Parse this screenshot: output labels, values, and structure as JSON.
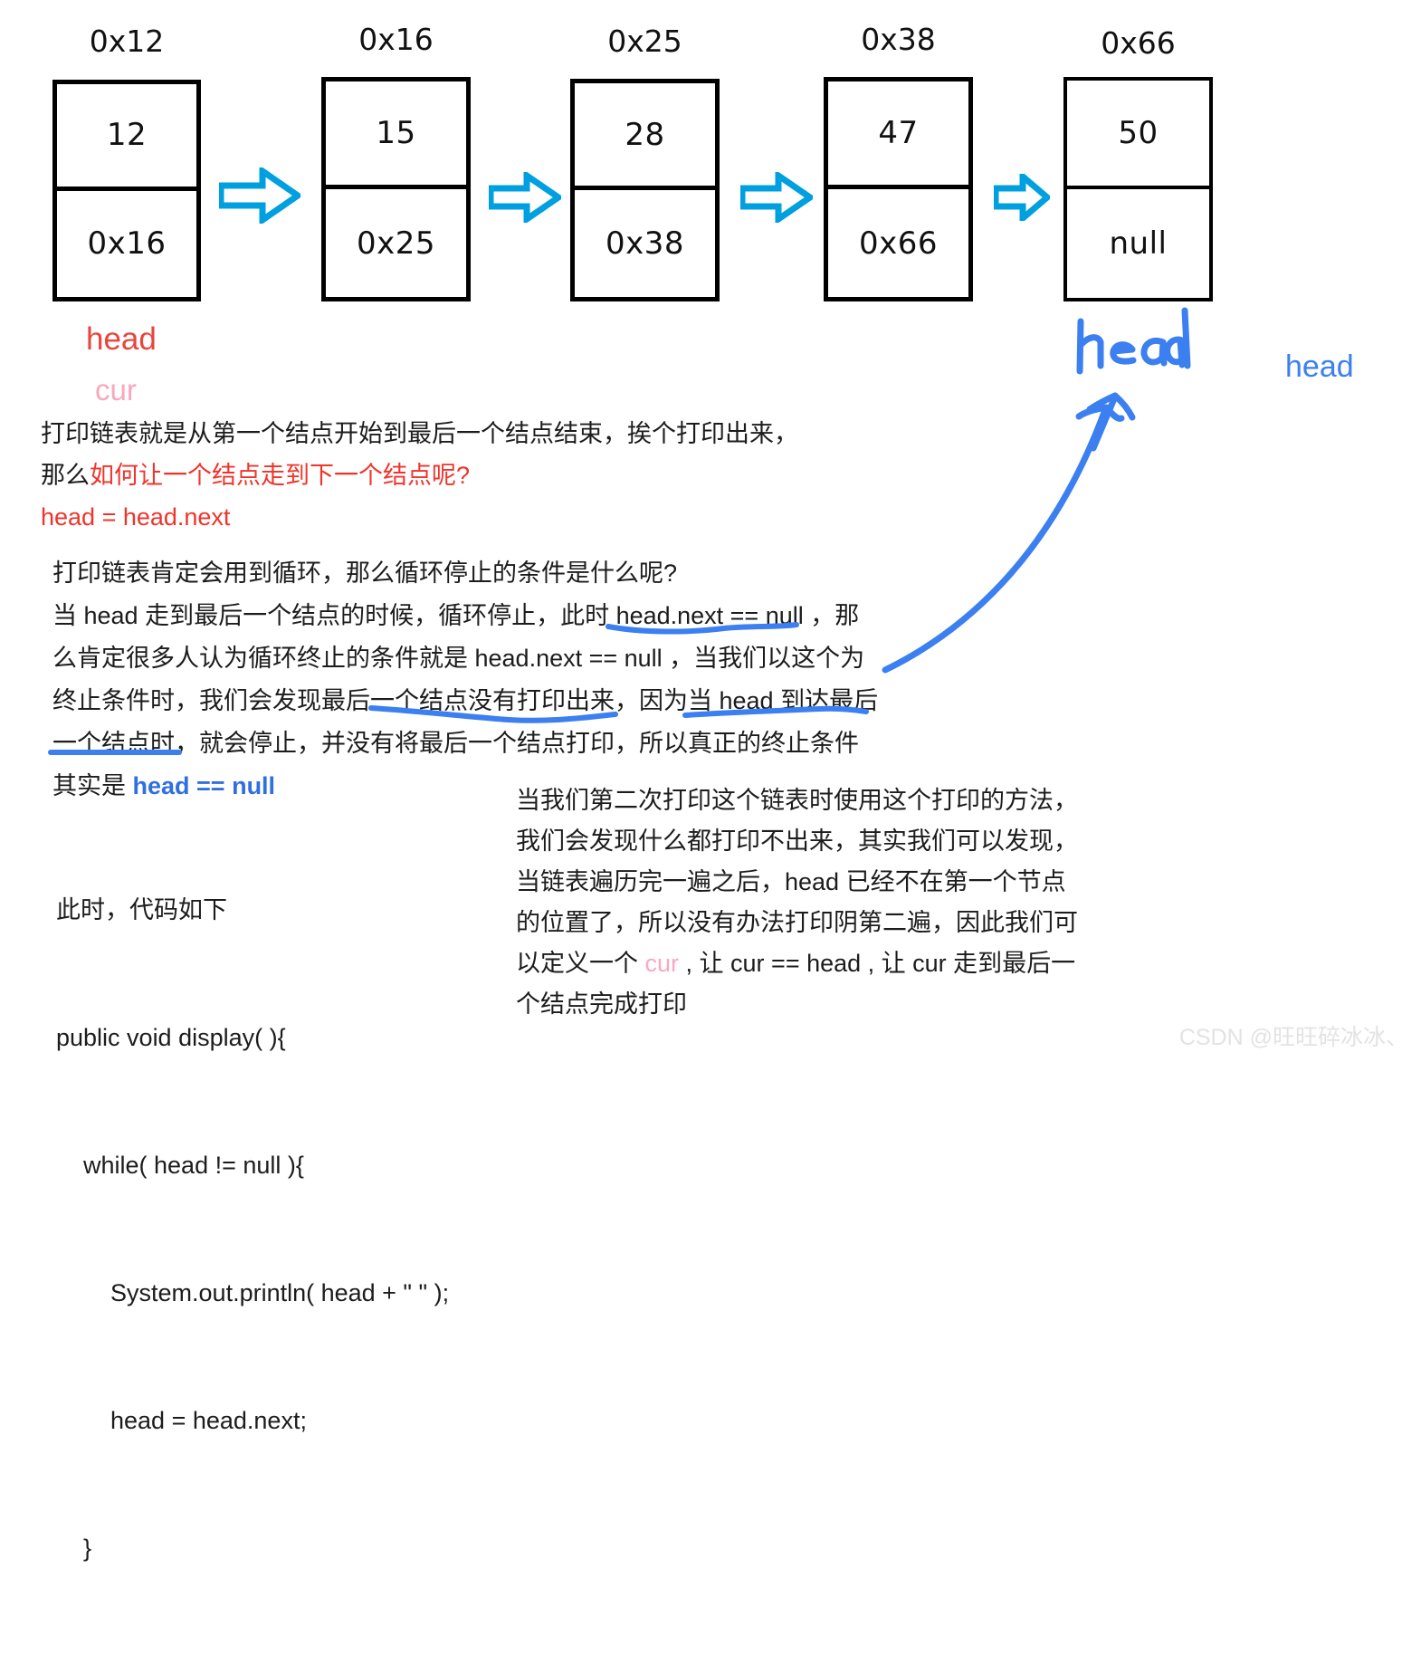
{
  "diagram": {
    "nodes": [
      {
        "address": "0x12",
        "value": "12",
        "next": "0x16"
      },
      {
        "address": "0x16",
        "value": "15",
        "next": "0x25"
      },
      {
        "address": "0x25",
        "value": "28",
        "next": "0x38"
      },
      {
        "address": "0x38",
        "value": "47",
        "next": "0x66"
      },
      {
        "address": "0x66",
        "value": "50",
        "next": "null"
      }
    ],
    "arrow_icon": "right-arrow-icon",
    "pointer_labels": {
      "head_red": "head",
      "cur_pink": "cur",
      "head_handwritten": "head",
      "head_blue": "head"
    }
  },
  "notes": {
    "intro": {
      "line1": "打印链表就是从第一个结点开始到最后一个结点结束，挨个打印出来，",
      "line2_prefix": "那么",
      "line2_red": "如何让一个结点走到下一个结点呢?",
      "line3_red": "head = head.next"
    },
    "body": {
      "line1": "打印链表肯定会用到循环，那么循环停止的条件是什么呢?",
      "line2": "当 head 走到最后一个结点的时候，循环停止，此时 head.next == null ，那",
      "line3": "么肯定很多人认为循环终止的条件就是 head.next == null ，当我们以这个为",
      "line4": "终止条件时，我们会发现最后一个结点没有打印出来，因为当 head 到达最后",
      "line5": "一个结点时，就会停止，并没有将最后一个结点打印，所以真正的终止条件",
      "line6_prefix": "其实是 ",
      "line6_blue": "head  == null"
    },
    "code": {
      "caption": "此时，代码如下",
      "lines": [
        "public void display( ){",
        "    while( head != null ){",
        "        System.out.println( head + \" \" );",
        "        head = head.next;",
        "    }"
      ]
    },
    "right_paragraph": {
      "line1": "当我们第二次打印这个链表时使用这个打印的方法，",
      "line2": "我们会发现什么都打印不出来，其实我们可以发现，",
      "line3": "当链表遍历完一遍之后，head 已经不在第一个节点",
      "line4": "的位置了，所以没有办法打印阴第二遍，因此我们可",
      "line5_a": "以定义一个 ",
      "line5_cur": "cur",
      "line5_b": " , 让 cur == head , 让 cur 走到最后一",
      "line6": "个结点完成打印"
    }
  },
  "watermark": "CSDN @旺旺碎冰冰、",
  "colors": {
    "node_border": "#000000",
    "arrow_blue": "#00a0e0",
    "red_text": "#f0342b",
    "pink_text": "#f8a9c0",
    "blue_text": "#2f6fe0",
    "ink_blue": "#3b7ff0",
    "watermark": "#e3e3e3"
  }
}
